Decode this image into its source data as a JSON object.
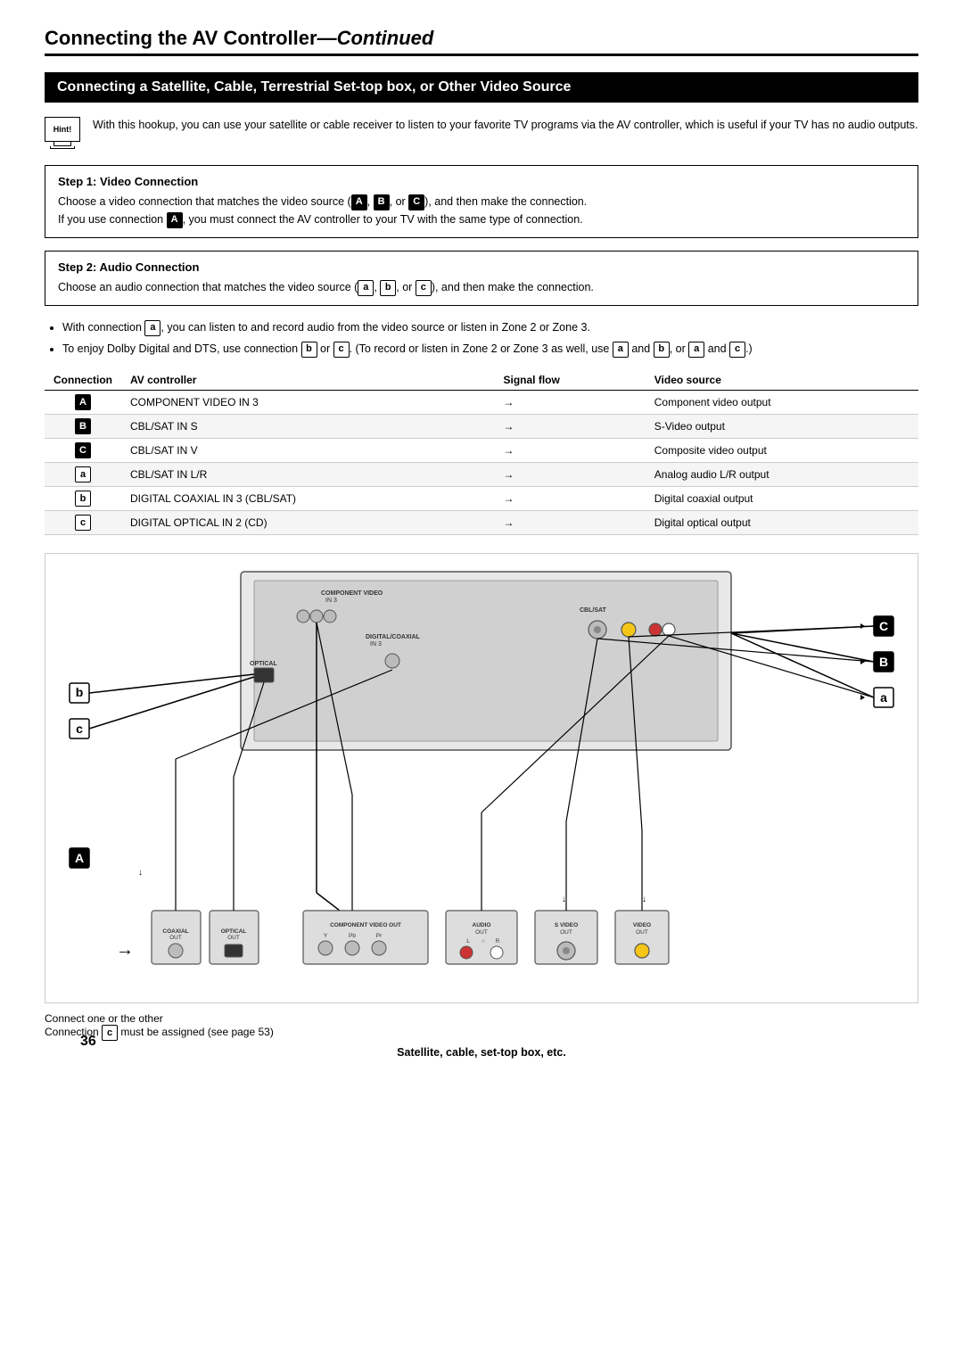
{
  "header": {
    "title_normal": "Connecting the AV Controller",
    "title_italic": "Continued"
  },
  "section": {
    "title": "Connecting a Satellite, Cable, Terrestrial Set-top box, or Other Video Source"
  },
  "hint": {
    "label": "Hint!",
    "text": "With this hookup, you can use your satellite or cable receiver to listen to your favorite TV programs via the AV controller, which is useful if your TV has no audio outputs."
  },
  "step1": {
    "title": "Step 1: Video Connection",
    "line1": "Choose a video connection that matches the video source (",
    "line1_badges": [
      "A",
      "B",
      "C"
    ],
    "line1_end": "), and then make the connection.",
    "line2": "If you use connection A, you must connect the AV controller to your TV with the same type of connection."
  },
  "step2": {
    "title": "Step 2: Audio Connection",
    "line1": "Choose an audio connection that matches the video source (",
    "line1_badges": [
      "a",
      "b",
      "c"
    ],
    "line1_end": "), and then make the connection."
  },
  "bullets": [
    "With connection a, you can listen to and record audio from the video source or listen in Zone 2 or Zone 3.",
    "To enjoy Dolby Digital and DTS, use connection b or c. (To record or listen in Zone 2 or Zone 3 as well, use a and b, or a and c.)"
  ],
  "table": {
    "headers": [
      "Connection",
      "AV controller",
      "Signal flow",
      "Video source"
    ],
    "rows": [
      {
        "badge": "A",
        "filled": true,
        "av": "COMPONENT VIDEO IN 3",
        "signal": "",
        "source": "Component video output"
      },
      {
        "badge": "B",
        "filled": true,
        "av": "CBL/SAT IN S",
        "signal": "",
        "source": "S-Video output"
      },
      {
        "badge": "C",
        "filled": true,
        "av": "CBL/SAT IN V",
        "signal": "",
        "source": "Composite video output"
      },
      {
        "badge": "a",
        "filled": false,
        "av": "CBL/SAT IN L/R",
        "signal": "",
        "source": "Analog audio L/R output"
      },
      {
        "badge": "b",
        "filled": false,
        "av": "DIGITAL COAXIAL IN 3 (CBL/SAT)",
        "signal": "",
        "source": "Digital coaxial output"
      },
      {
        "badge": "c",
        "filled": false,
        "av": "DIGITAL OPTICAL IN 2 (CD)",
        "signal": "",
        "source": "Digital optical output"
      }
    ]
  },
  "diagram_labels": {
    "b_left": "b",
    "c_left": "c",
    "A_left": "A",
    "C_right": "C",
    "B_right": "B",
    "a_right": "a"
  },
  "footer": {
    "note1": "Connect one or the other",
    "note2": "Connection c must be assigned (see page 53)",
    "caption": "Satellite, cable, set-top box, etc."
  },
  "page_number": "36"
}
